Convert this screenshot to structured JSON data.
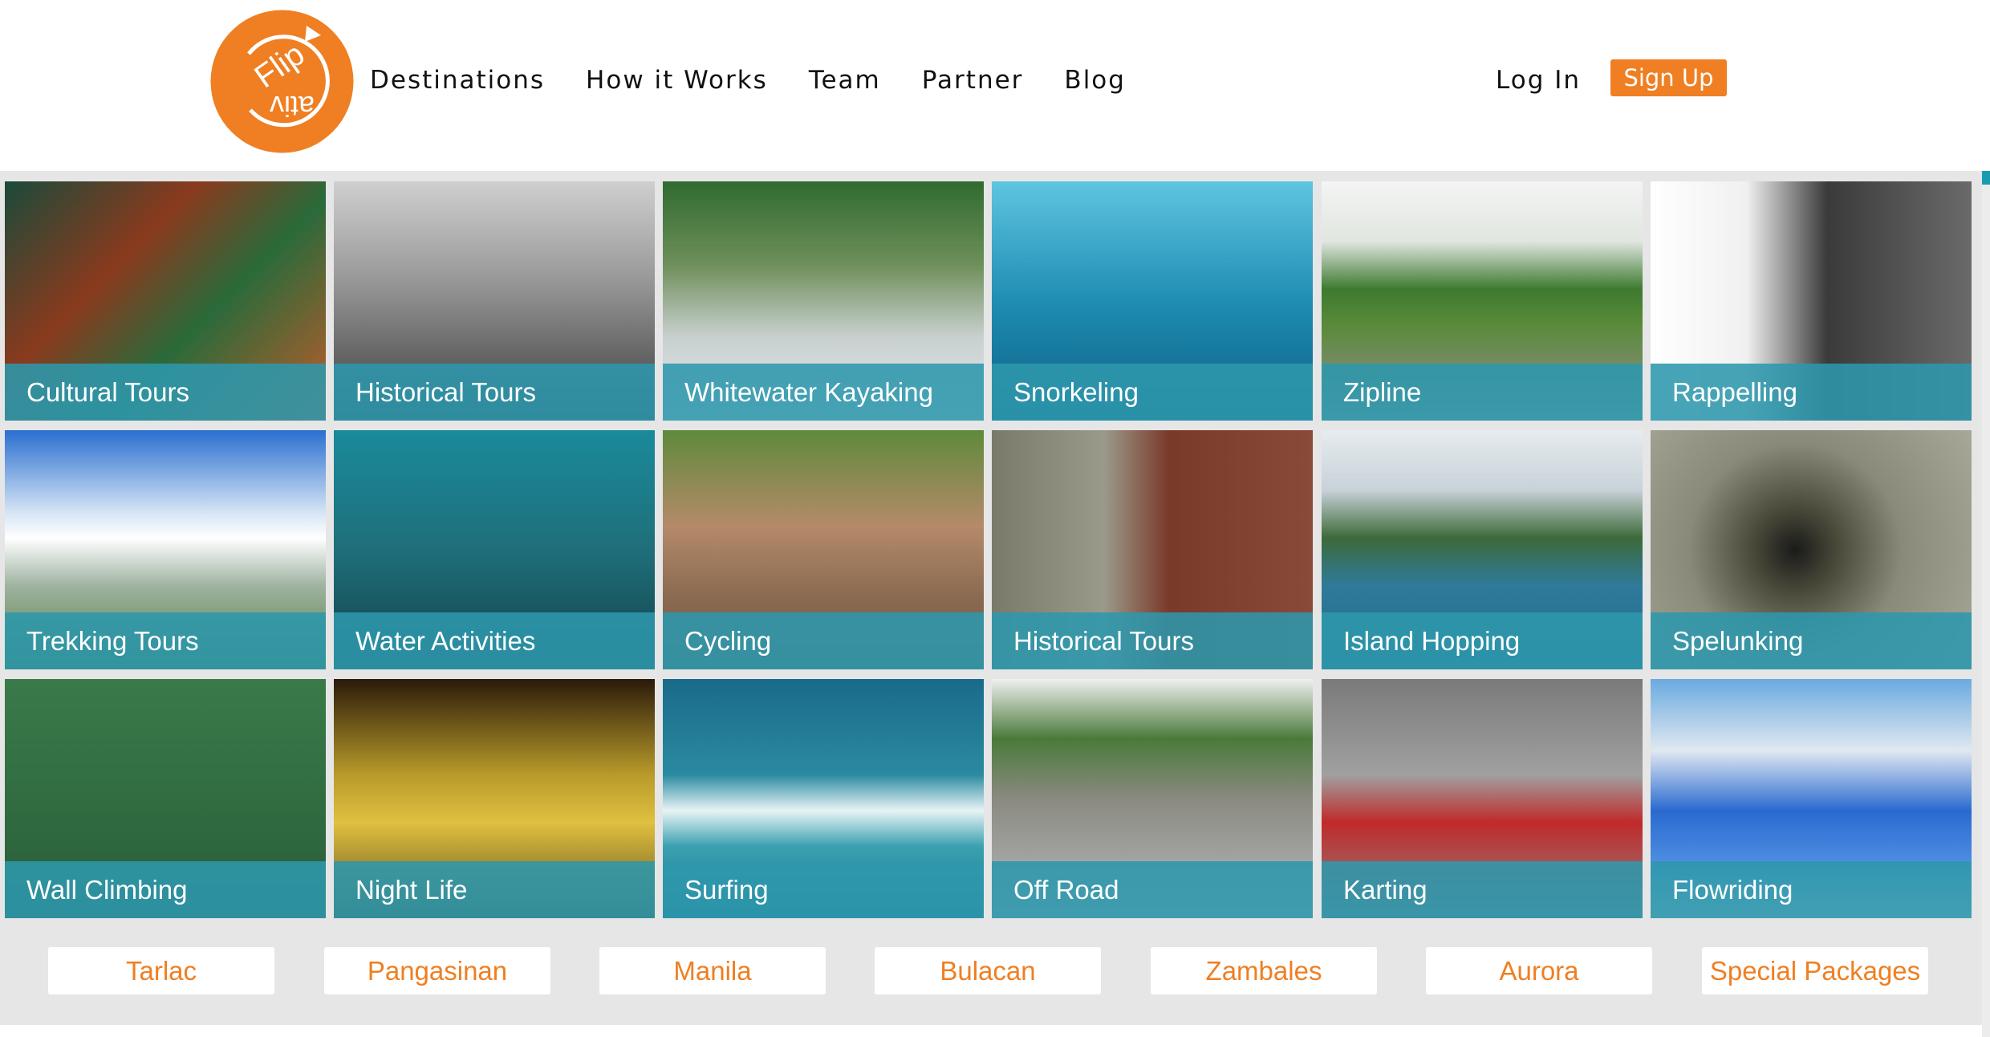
{
  "brand": {
    "logo_text": "Flip ativ",
    "color": "#ef7f22"
  },
  "nav": {
    "items": [
      {
        "label": "Destinations"
      },
      {
        "label": "How it Works"
      },
      {
        "label": "Team"
      },
      {
        "label": "Partner"
      },
      {
        "label": "Blog"
      }
    ],
    "login_label": "Log In",
    "signup_label": "Sign Up"
  },
  "activities": [
    {
      "label": "Cultural Tours"
    },
    {
      "label": "Historical Tours"
    },
    {
      "label": "Whitewater Kayaking"
    },
    {
      "label": "Snorkeling"
    },
    {
      "label": "Zipline"
    },
    {
      "label": "Rappelling"
    },
    {
      "label": "Trekking Tours"
    },
    {
      "label": "Water Activities"
    },
    {
      "label": "Cycling"
    },
    {
      "label": "Historical Tours"
    },
    {
      "label": "Island Hopping"
    },
    {
      "label": "Spelunking"
    },
    {
      "label": "Wall Climbing"
    },
    {
      "label": "Night Life"
    },
    {
      "label": "Surfing"
    },
    {
      "label": "Off Road"
    },
    {
      "label": "Karting"
    },
    {
      "label": "Flowriding"
    }
  ],
  "destinations": [
    {
      "label": "Tarlac"
    },
    {
      "label": "Pangasinan"
    },
    {
      "label": "Manila"
    },
    {
      "label": "Bulacan"
    },
    {
      "label": "Zambales"
    },
    {
      "label": "Aurora"
    },
    {
      "label": "Special Packages"
    }
  ],
  "colors": {
    "accent": "#ef7f22",
    "label_bar": "#2e97ac",
    "grid_bg": "#e6e6e6"
  }
}
